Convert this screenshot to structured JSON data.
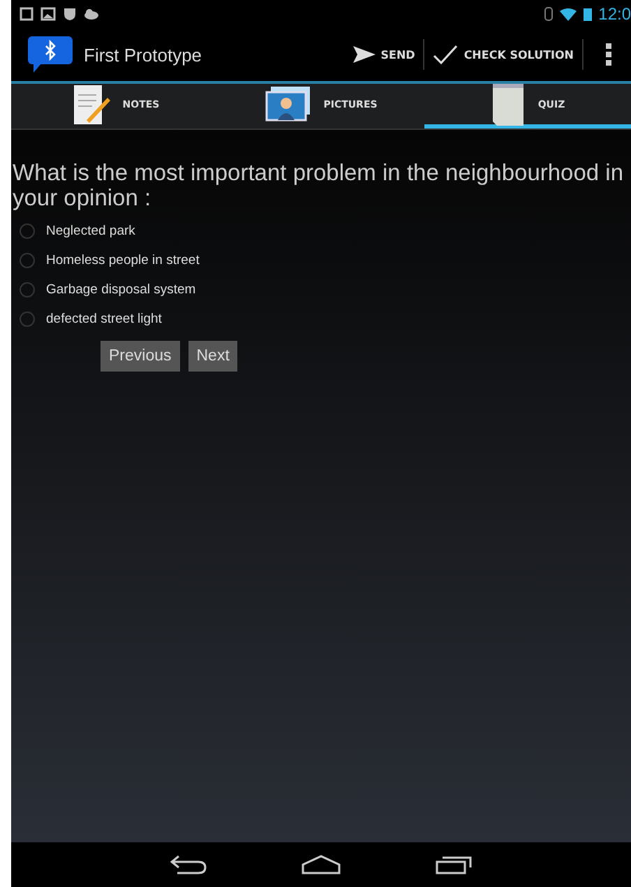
{
  "status_bar": {
    "time": "12:0"
  },
  "action_bar": {
    "title": "First Prototype",
    "actions": [
      {
        "label": "SEND",
        "kind": "send"
      },
      {
        "label": "CHECK SOLUTION",
        "kind": "check"
      }
    ]
  },
  "tabs": [
    {
      "label": "NOTES",
      "kind": "notes",
      "selected": false
    },
    {
      "label": "PICTURES",
      "kind": "pictures",
      "selected": false
    },
    {
      "label": "QUIZ",
      "kind": "quiz",
      "selected": true
    }
  ],
  "question": "What is the most important problem in the neighbourhood in your opinion :",
  "options": [
    {
      "label": "Neglected park",
      "selected": false
    },
    {
      "label": "Homeless people in street",
      "selected": false
    },
    {
      "label": "Garbage disposal system",
      "selected": false
    },
    {
      "label": "defected street light",
      "selected": false
    }
  ],
  "buttons": [
    "Previous",
    "Next"
  ]
}
